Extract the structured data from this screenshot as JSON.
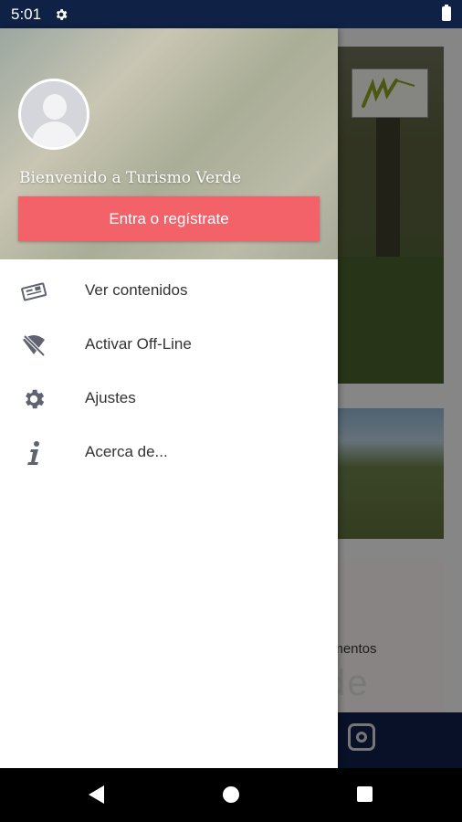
{
  "status_bar": {
    "time": "5:01",
    "icons": [
      "settings-gear-icon",
      "battery-icon"
    ]
  },
  "drawer": {
    "welcome_text": "Bienvenido a Turismo Verde",
    "login_button": "Entra o regístrate",
    "items": [
      {
        "label": "Ver contenidos",
        "icon": "newspaper-icon"
      },
      {
        "label": "Activar Off-Line",
        "icon": "wifi-off-icon"
      },
      {
        "label": "Ajustes",
        "icon": "gear-icon"
      },
      {
        "label": "Acerca de...",
        "icon": "info-icon"
      }
    ]
  },
  "background": {
    "partial_word": "ramentos",
    "partial_large_word": "de"
  },
  "colors": {
    "status_bar": "#0f2145",
    "login_button": "#f46269",
    "icon_color": "#5f6370",
    "bottom_nav": "#10204a"
  }
}
